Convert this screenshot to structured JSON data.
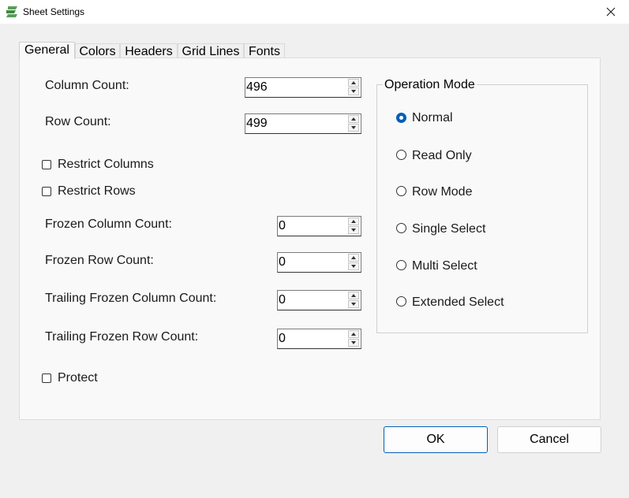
{
  "window": {
    "title": "Sheet Settings"
  },
  "tabs": [
    {
      "label": "General",
      "active": true
    },
    {
      "label": "Colors"
    },
    {
      "label": "Headers"
    },
    {
      "label": "Grid Lines"
    },
    {
      "label": "Fonts"
    }
  ],
  "general": {
    "column_count": {
      "label": "Column Count:",
      "value": "496"
    },
    "row_count": {
      "label": "Row Count:",
      "value": "499"
    },
    "restrict_columns": {
      "label": "Restrict Columns",
      "checked": false
    },
    "restrict_rows": {
      "label": "Restrict Rows",
      "checked": false
    },
    "frozen_column_count": {
      "label": "Frozen Column Count:",
      "value": "0"
    },
    "frozen_row_count": {
      "label": "Frozen Row Count:",
      "value": "0"
    },
    "trailing_frozen_column_count": {
      "label": "Trailing Frozen Column Count:",
      "value": "0"
    },
    "trailing_frozen_row_count": {
      "label": "Trailing Frozen Row Count:",
      "value": "0"
    },
    "protect": {
      "label": "Protect",
      "checked": false
    }
  },
  "operation_mode": {
    "title": "Operation Mode",
    "selected": "Normal",
    "options": [
      "Normal",
      "Read Only",
      "Row Mode",
      "Single Select",
      "Multi Select",
      "Extended Select"
    ]
  },
  "buttons": {
    "ok": "OK",
    "cancel": "Cancel"
  },
  "colors": {
    "accent": "#005fb8",
    "window_bg": "#f0f0f0",
    "panel_bg": "#f9f9f9",
    "logo": "#4c9a4c"
  }
}
